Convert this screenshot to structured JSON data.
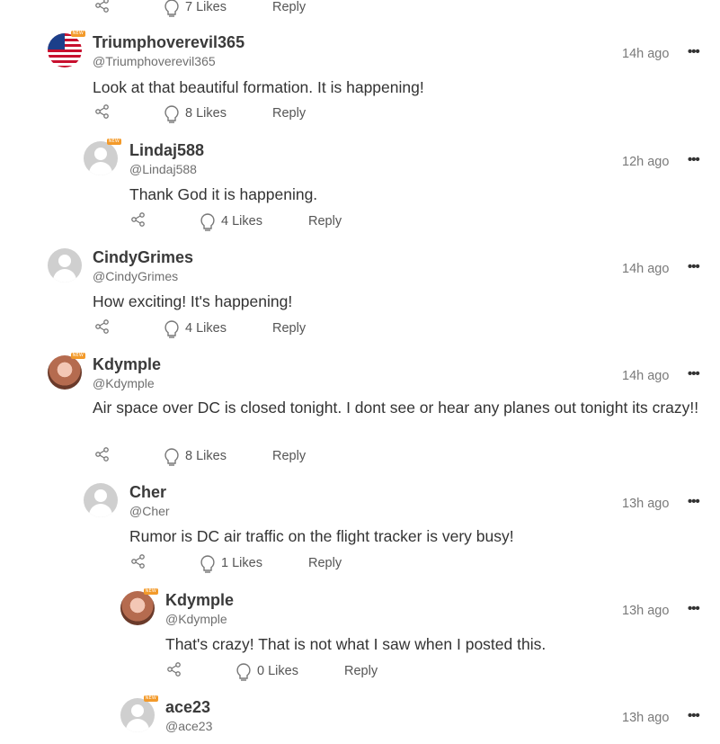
{
  "top_partial": {
    "likes": "7 Likes",
    "reply": "Reply"
  },
  "comments": [
    {
      "name": "Triumphoverevil365",
      "handle": "@Triumphoverevil365",
      "time": "14h ago",
      "body": "Look at that beautiful formation.  It is happening!",
      "likes": "8 Likes",
      "reply": "Reply",
      "avatar": "us-flag",
      "badge": "NEW"
    },
    {
      "name": "Lindaj588",
      "handle": "@Lindaj588",
      "time": "12h ago",
      "body": "Thank God it is happening.",
      "likes": "4 Likes",
      "reply": "Reply",
      "avatar": "default",
      "badge": "NEW"
    },
    {
      "name": "CindyGrimes",
      "handle": "@CindyGrimes",
      "time": "14h ago",
      "body": "How exciting!  It's happening!",
      "likes": "4 Likes",
      "reply": "Reply",
      "avatar": "default",
      "badge": ""
    },
    {
      "name": "Kdymple",
      "handle": "@Kdymple",
      "time": "14h ago",
      "body": "Air space over DC is closed tonight. I dont see or hear any planes out tonight its crazy!!",
      "likes": "8 Likes",
      "reply": "Reply",
      "avatar": "photo",
      "badge": "NEW"
    },
    {
      "name": "Cher",
      "handle": "@Cher",
      "time": "13h ago",
      "body": "Rumor is DC air traffic on the flight tracker is very busy!",
      "likes": "1 Likes",
      "reply": "Reply",
      "avatar": "default",
      "badge": ""
    },
    {
      "name": "Kdymple",
      "handle": "@Kdymple",
      "time": "13h ago",
      "body": "That's crazy! That is not what I saw when I posted this.",
      "likes": "0 Likes",
      "reply": "Reply",
      "avatar": "photo",
      "badge": "NEW"
    },
    {
      "name": "ace23",
      "handle": "@ace23",
      "time": "13h ago",
      "body": "",
      "likes": "",
      "reply": "",
      "avatar": "default",
      "badge": "NEW"
    }
  ],
  "more_label": "•••",
  "colors": {
    "badge": "#f39a2a",
    "text": "#333333",
    "muted": "#7a7a7a"
  },
  "icons": {
    "share": "share-icon",
    "like": "lightbulb-icon",
    "more": "more-options-icon"
  }
}
